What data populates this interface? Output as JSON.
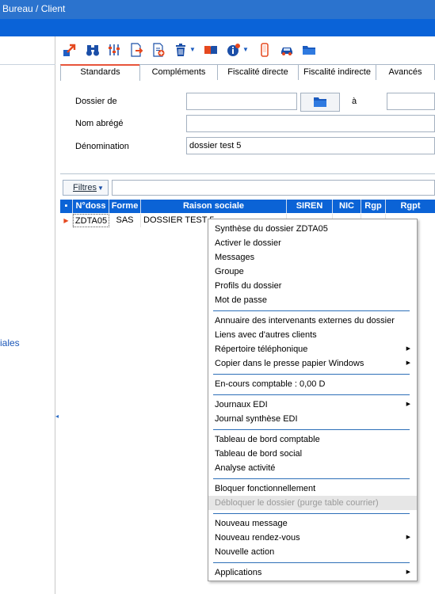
{
  "window": {
    "title": "Bureau / Client"
  },
  "left_panel": {
    "partial_label": "iales"
  },
  "toolbar": {
    "icons": [
      "arrow-icon",
      "binoculars-icon",
      "sliders-icon",
      "document-export-icon",
      "document-add-icon",
      "trash-icon",
      "book-icon",
      "info-icon",
      "phone-icon",
      "car-icon",
      "folder-icon"
    ]
  },
  "tabs": [
    "Standards",
    "Compléments",
    "Fiscalité directe",
    "Fiscalité indirecte",
    "Avancés"
  ],
  "form": {
    "dossier_de_label": "Dossier de",
    "dossier_de_value": "",
    "a_label": "à",
    "dossier_a_value": "",
    "nom_abrege_label": "Nom abrégé",
    "nom_abrege_value": "",
    "denomination_label": "Dénomination",
    "denomination_value": "dossier test 5"
  },
  "filters": {
    "button_label": "Filtres",
    "value": ""
  },
  "grid": {
    "columns": [
      "N°doss",
      "Forme",
      "Raison sociale",
      "SIREN",
      "NIC",
      "Rgp",
      "Rgpt"
    ],
    "rows": [
      {
        "ndoss": "ZDTA05",
        "forme": "SAS",
        "raison": "DOSSIER TEST 5",
        "siren": "",
        "nic": "",
        "rgp": "",
        "rgpt": ""
      }
    ]
  },
  "context_menu": {
    "items": [
      {
        "label": "Synthèse du dossier ZDTA05",
        "submenu": false,
        "disabled": false
      },
      {
        "label": "Activer le dossier",
        "submenu": false,
        "disabled": false
      },
      {
        "label": "Messages",
        "submenu": false,
        "disabled": false
      },
      {
        "label": "Groupe",
        "submenu": false,
        "disabled": false
      },
      {
        "label": "Profils du dossier",
        "submenu": false,
        "disabled": false
      },
      {
        "label": "Mot de passe",
        "submenu": false,
        "disabled": false
      },
      {
        "label": "Annuaire des intervenants externes du dossier",
        "submenu": false,
        "disabled": false
      },
      {
        "label": "Liens avec d'autres clients",
        "submenu": false,
        "disabled": false
      },
      {
        "label": "Répertoire téléphonique",
        "submenu": true,
        "disabled": false
      },
      {
        "label": "Copier dans le presse papier Windows",
        "submenu": true,
        "disabled": false
      },
      {
        "label": "En-cours comptable : 0,00 D",
        "submenu": false,
        "disabled": false
      },
      {
        "label": "Journaux EDI",
        "submenu": true,
        "disabled": false
      },
      {
        "label": "Journal synthèse EDI",
        "submenu": false,
        "disabled": false
      },
      {
        "label": "Tableau de bord comptable",
        "submenu": false,
        "disabled": false
      },
      {
        "label": "Tableau de bord social",
        "submenu": false,
        "disabled": false
      },
      {
        "label": "Analyse activité",
        "submenu": false,
        "disabled": false
      },
      {
        "label": "Bloquer fonctionnellement",
        "submenu": false,
        "disabled": false
      },
      {
        "label": "Débloquer le dossier (purge table courrier)",
        "submenu": false,
        "disabled": true
      },
      {
        "label": "Nouveau message",
        "submenu": false,
        "disabled": false
      },
      {
        "label": "Nouveau rendez-vous",
        "submenu": true,
        "disabled": false
      },
      {
        "label": "Nouvelle action",
        "submenu": false,
        "disabled": false
      },
      {
        "label": "Applications",
        "submenu": true,
        "disabled": false
      }
    ]
  },
  "colors": {
    "title_bar": "#2b73ce",
    "menu_bar": "#0a63d8",
    "grid_header": "#0b63d6",
    "active_tab_accent": "#e8543a",
    "menu_separator": "#2d6fb8"
  }
}
